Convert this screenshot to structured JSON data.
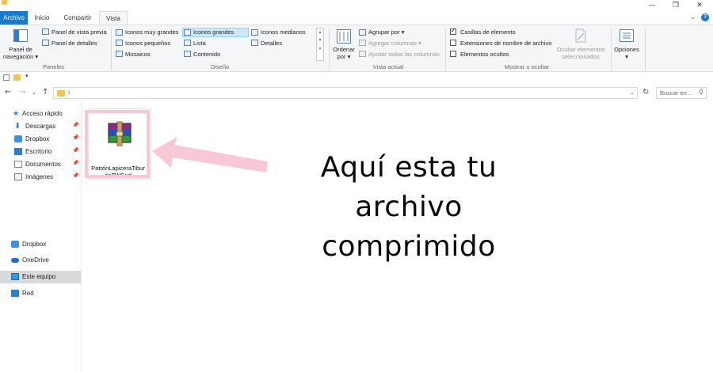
{
  "window": {
    "minimize_glyph": "—",
    "restore_glyph": "❐",
    "close_glyph": "✕"
  },
  "tabs": [
    "Archivo",
    "Inicio",
    "Compartir",
    "Vista"
  ],
  "ribbon": {
    "paneles": {
      "group_label": "Paneles",
      "panel_navegacion_1": "Panel de",
      "panel_navegacion_2": "navegación ▾",
      "vista_previa": "Panel de vista previa",
      "detalles": "Panel de detalles"
    },
    "diseno": {
      "group_label": "Diseño",
      "muy_grandes": "Iconos muy grandes",
      "grandes": "Iconos grandes",
      "medianos": "Iconos medianos",
      "pequenos": "Iconos pequeños",
      "lista": "Lista",
      "detalles": "Detalles",
      "mosaicos": "Mosaicos",
      "contenido": "Contenido"
    },
    "vista_actual": {
      "group_label": "Vista actual",
      "ordenar_1": "Ordenar",
      "ordenar_2": "por ▾",
      "agrupar": "Agrupar por ▾",
      "agregar_columnas": "Agregar columnas ▾",
      "ajustar": "Ajustar todas las columnas"
    },
    "mostrar": {
      "group_label": "Mostrar u ocultar",
      "casillas": "Casillas de elemento",
      "extensiones": "Extensiones de nombre de archivo",
      "ocultos": "Elementos ocultos",
      "ocultar_sel_1": "Ocultar elementos",
      "ocultar_sel_2": "seleccionados",
      "casillas_checked": true,
      "extensiones_checked": false,
      "ocultos_checked": false
    },
    "opciones": {
      "label": "Opciones",
      "arrow": "▾"
    }
  },
  "address": {
    "path_chevron": "›",
    "search_placeholder": "Buscar en ..."
  },
  "nav": {
    "quick_access": "Acceso rápido",
    "descargas": "Descargas",
    "dropbox_qa": "Dropbox",
    "escritorio": "Escritorio",
    "documentos": "Documentos",
    "imagenes": "Imágenes",
    "dropbox": "Dropbox",
    "onedrive": "OneDrive",
    "este_equipo": "Este equipo",
    "red": "Red"
  },
  "file": {
    "name": "PatrónLapiceraTiburónTWCurl"
  },
  "annotation": {
    "line1": "Aquí esta tu",
    "line2": "archivo",
    "line3": "comprimido",
    "arrow_color": "#f8c9d4"
  },
  "colors": {
    "accent": "#1979ca",
    "selection": "#cce8ff",
    "nav_selected": "#d9d9d9",
    "highlight_pink": "#f8c9d4"
  }
}
